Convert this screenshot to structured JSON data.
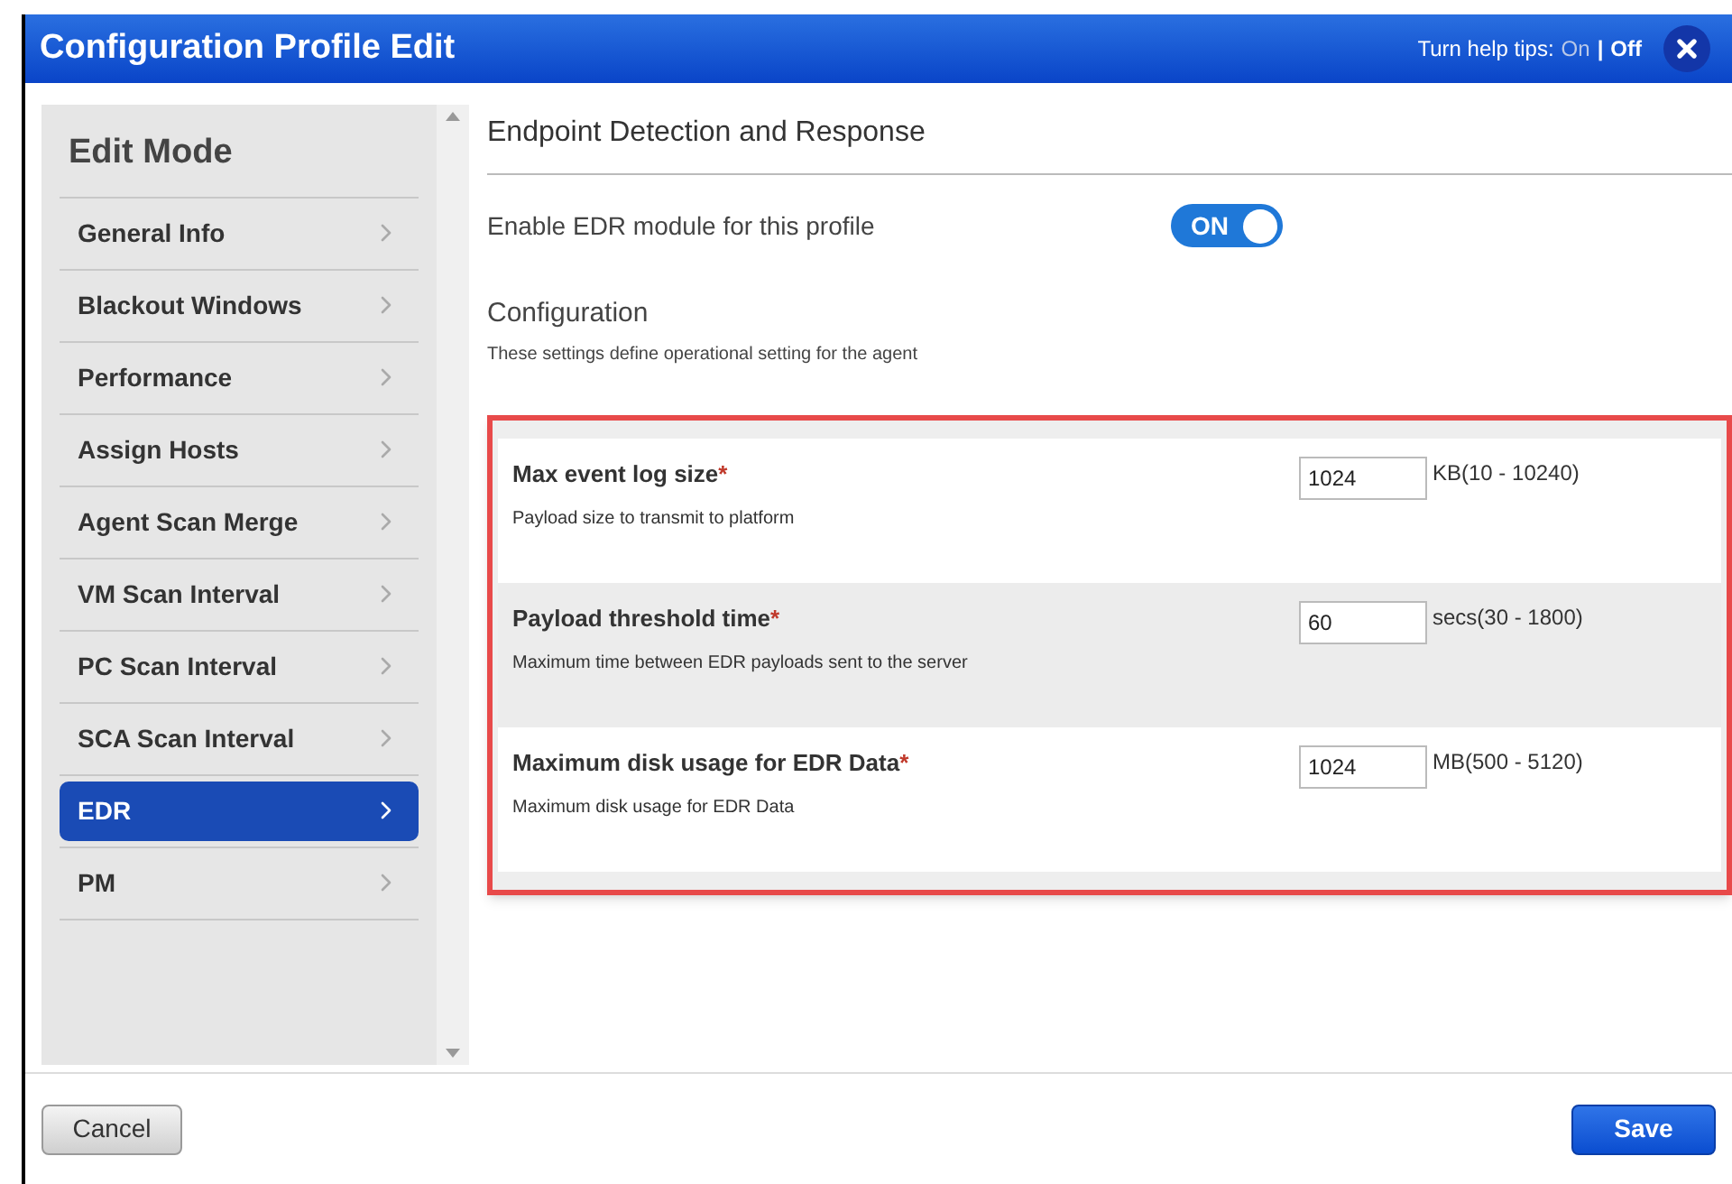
{
  "window": {
    "title": "Configuration Profile Edit"
  },
  "help_tips": {
    "label": "Turn help tips:",
    "separator": "|",
    "options": [
      {
        "label": "On",
        "selected": false
      },
      {
        "label": "Off",
        "selected": true
      }
    ]
  },
  "sidebar": {
    "title": "Edit Mode",
    "items": [
      {
        "label": "General Info",
        "selected": false
      },
      {
        "label": "Blackout Windows",
        "selected": false
      },
      {
        "label": "Performance",
        "selected": false
      },
      {
        "label": "Assign Hosts",
        "selected": false
      },
      {
        "label": "Agent Scan Merge",
        "selected": false
      },
      {
        "label": "VM Scan Interval",
        "selected": false
      },
      {
        "label": "PC Scan Interval",
        "selected": false
      },
      {
        "label": "SCA Scan Interval",
        "selected": false
      },
      {
        "label": "EDR",
        "selected": true
      },
      {
        "label": "PM",
        "selected": false
      }
    ]
  },
  "section": {
    "title": "Endpoint Detection and Response",
    "enable": {
      "label": "Enable EDR module for this profile",
      "on": true,
      "toggle_text": "ON"
    },
    "configuration": {
      "title": "Configuration",
      "description": "These settings define operational setting for the agent"
    },
    "settings": [
      {
        "label": "Max event log size",
        "mark": "*",
        "description": "Payload size to transmit to platform",
        "value": "1024",
        "range": "KB(10 - 10240)"
      },
      {
        "label": "Payload threshold time",
        "mark": "*",
        "description": "Maximum time between EDR payloads sent to the server",
        "value": "60",
        "range": "secs(30 - 1800)"
      },
      {
        "label": "Maximum disk usage for EDR Data",
        "mark": "*",
        "description": "Maximum disk usage for EDR Data",
        "value": "1024",
        "range": "MB(500 - 5120)"
      }
    ]
  },
  "buttons": [
    {
      "label": "Cancel",
      "kind": "secondary"
    },
    {
      "label": "Save",
      "kind": "primary"
    }
  ]
}
